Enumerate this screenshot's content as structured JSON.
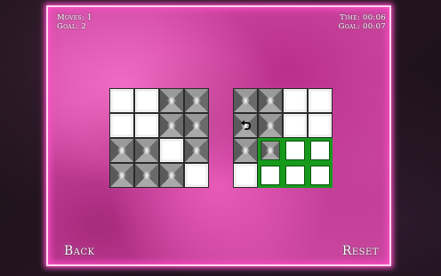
{
  "hud": {
    "moves_text": "Moves: 1",
    "goal_text": "Goal: 2",
    "time_text": "Time: 00:06",
    "goal_time_text": "Goal: 00:07"
  },
  "left_grid": {
    "rows": [
      [
        "white",
        "white",
        "grey",
        "grey"
      ],
      [
        "white",
        "white",
        "grey",
        "grey"
      ],
      [
        "grey",
        "grey",
        "white",
        "grey"
      ],
      [
        "grey",
        "grey",
        "grey",
        "white"
      ]
    ]
  },
  "right_grid": {
    "rows": [
      [
        "grey",
        "grey",
        "white",
        "white"
      ],
      [
        "grey",
        "grey",
        "white",
        "white"
      ],
      [
        "grey",
        "grey",
        "white",
        "white"
      ],
      [
        "white",
        "white",
        "white",
        "white"
      ]
    ],
    "goal_cells": [
      [
        2,
        1
      ],
      [
        2,
        2
      ],
      [
        2,
        3
      ],
      [
        3,
        1
      ],
      [
        3,
        2
      ],
      [
        3,
        3
      ]
    ],
    "undo_cell": [
      1,
      0
    ]
  },
  "buttons": {
    "back_label": "Back",
    "reset_label": "Reset"
  },
  "colors": {
    "frame_glow": "#ff4fc8",
    "goal_border": "#179a1c",
    "tile_white": "#ffffff",
    "tile_grey": "#8a8a8a"
  },
  "icons": {
    "undo": "undo-arrow-icon"
  }
}
